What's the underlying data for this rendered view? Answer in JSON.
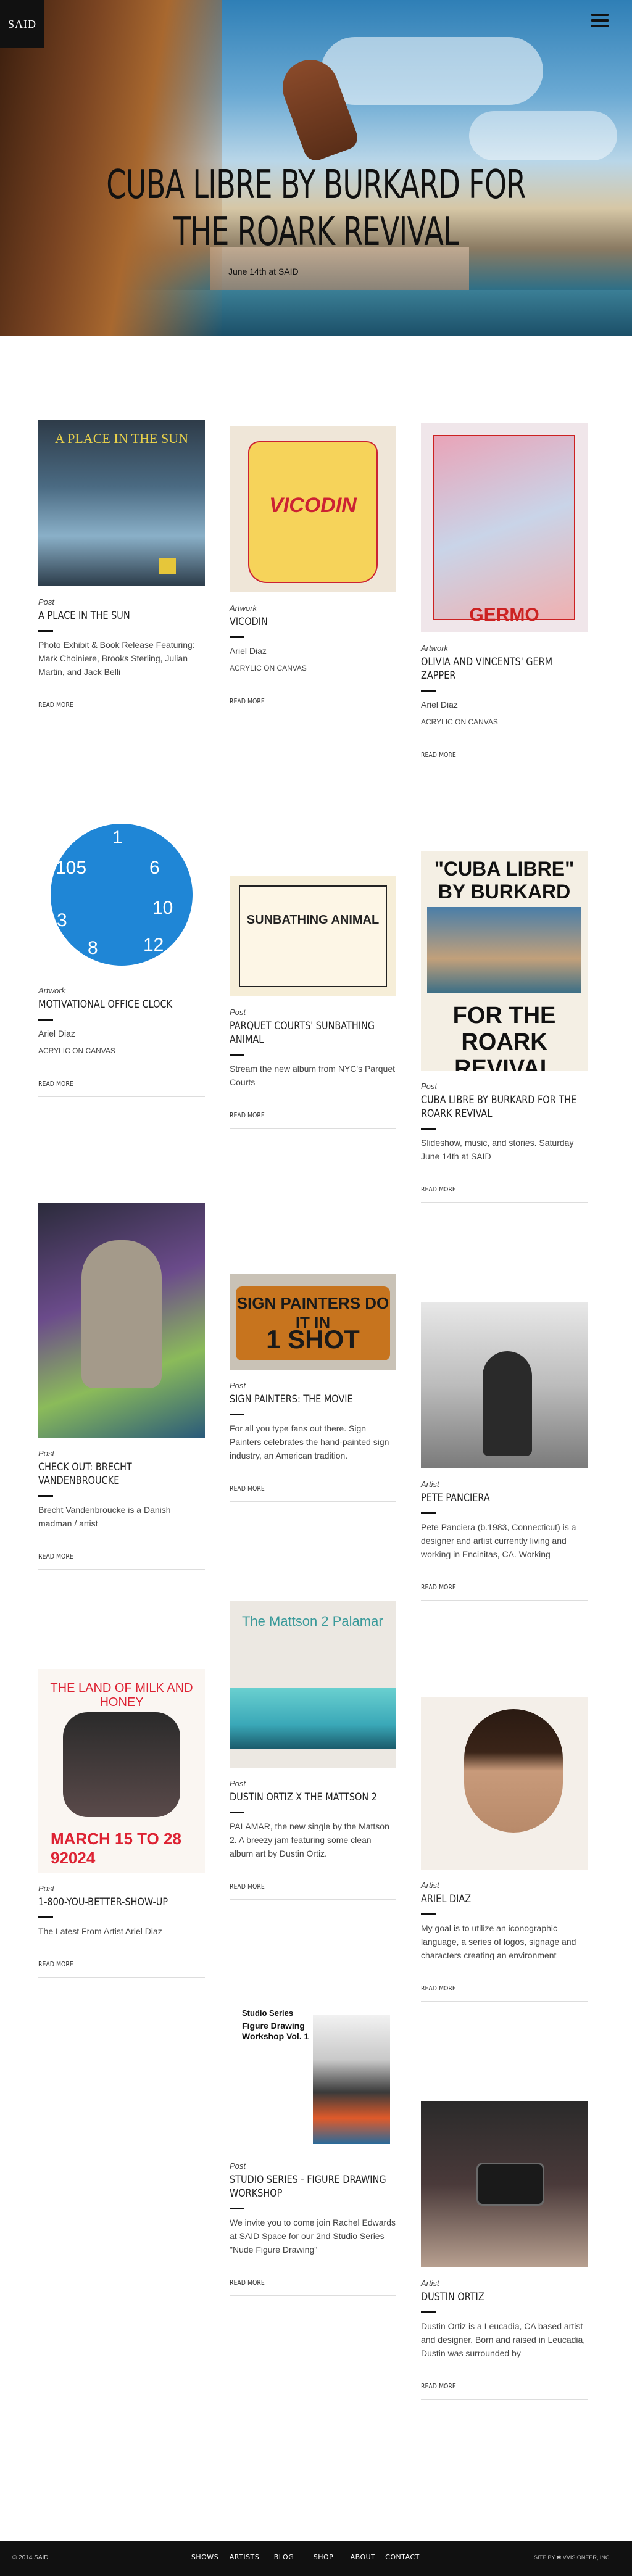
{
  "header": {
    "logo": "SAID",
    "menu_icon": "hamburger-menu-icon"
  },
  "hero": {
    "title": "CUBA LIBRE BY BURKARD FOR THE ROARK REVIVAL",
    "subtitle": "June 14th at SAID"
  },
  "cards": [
    {
      "category": "Post",
      "title": "A PLACE IN THE SUN",
      "description": "Photo Exhibit & Book Release Featuring: Mark Choiniere, Brooks Sterling, Julian Martin, and Jack Belli",
      "more": "READ MORE",
      "thumb_text": "A PLACE IN THE SUN"
    },
    {
      "category": "Artwork",
      "title": "VICODIN",
      "artist": "Ariel Diaz",
      "medium": "ACRYLIC ON CANVAS",
      "more": "READ MORE",
      "thumb_text": "VICODIN"
    },
    {
      "category": "Artwork",
      "title": "OLIVIA AND VINCENTS' GERM ZAPPER",
      "artist": "Ariel Diaz",
      "medium": "ACRYLIC ON CANVAS",
      "more": "READ MORE",
      "thumb_text": "GERMO"
    },
    {
      "category": "Artwork",
      "title": "MOTIVATIONAL OFFICE CLOCK",
      "artist": "Ariel Diaz",
      "medium": "ACRYLIC ON CANVAS",
      "more": "READ MORE"
    },
    {
      "category": "Post",
      "title": "PARQUET COURTS' SUNBATHING ANIMAL",
      "description": "Stream the new album from NYC's Parquet Courts",
      "more": "READ MORE",
      "thumb_text": "SUNBATHING ANIMAL"
    },
    {
      "category": "Post",
      "title": "CUBA LIBRE BY BURKARD FOR THE ROARK REVIVAL",
      "description": "Slideshow, music, and stories. Saturday June 14th at SAID",
      "more": "READ MORE",
      "thumb_top": "\"CUBA LIBRE\" BY BURKARD",
      "thumb_bottom": "FOR THE ROARK REVIVAL"
    },
    {
      "category": "Post",
      "title": "CHECK OUT: BRECHT VANDENBROUCKE",
      "description": "Brecht Vandenbroucke is a Danish madman / artist",
      "more": "READ MORE"
    },
    {
      "category": "Post",
      "title": "SIGN PAINTERS: THE MOVIE",
      "description": "For all you type fans out there. Sign Painters celebrates the hand-painted sign industry, an American tradition.",
      "more": "READ MORE",
      "thumb_top": "SIGN PAINTERS DO IT IN",
      "thumb_bottom": "1 SHOT"
    },
    {
      "category": "Artist",
      "title": "PETE PANCIERA",
      "description": "Pete Panciera (b.1983, Connecticut) is a designer and artist currently living and working in Encinitas, CA. Working",
      "more": "READ MORE"
    },
    {
      "category": "Post",
      "title": "DUSTIN ORTIZ X THE MATTSON 2",
      "description": "PALAMAR, the new single by the Mattson 2. A breezy jam featuring some clean album art by Dustin Ortiz.",
      "more": "READ MORE",
      "thumb_text": "The Mattson 2 Palamar"
    },
    {
      "category": "Post",
      "title": "1-800-YOU-BETTER-SHOW-UP",
      "description": "The Latest From Artist Ariel Diaz",
      "more": "READ MORE",
      "thumb_top": "THE LAND OF MILK AND HONEY",
      "thumb_bottom": "MARCH 15 TO 28 92024"
    },
    {
      "category": "Artist",
      "title": "ARIEL DIAZ",
      "description": "My goal is to utilize an iconographic language, a series of logos, signage and characters creating an environment",
      "more": "READ MORE"
    },
    {
      "category": "Post",
      "title": "STUDIO SERIES - FIGURE DRAWING WORKSHOP",
      "description": "We invite you to come join Rachel Edwards at SAID Space for our 2nd Studio Series \"Nude Figure Drawing\"",
      "more": "READ MORE",
      "thumb_label": "Studio Series",
      "thumb_heading": "Figure Drawing Workshop Vol. 1"
    },
    {
      "category": "Artist",
      "title": "DUSTIN ORTIZ",
      "description": "Dustin Ortiz is a Leucadia, CA based artist and designer. Born and raised in Leucadia, Dustin was surrounded by",
      "more": "READ MORE"
    }
  ],
  "footer": {
    "copyright": "© 2014 SAID",
    "nav": [
      "SHOWS",
      "ARTISTS",
      "BLOG",
      "SHOP",
      "ABOUT",
      "CONTACT"
    ],
    "credit": "SITE BY ✱ VVISIONEER, INC."
  }
}
